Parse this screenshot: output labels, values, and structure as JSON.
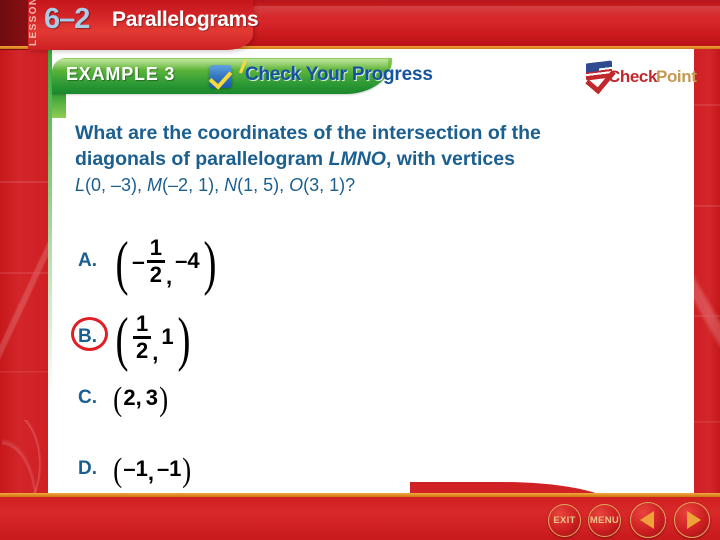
{
  "header": {
    "lesson_word": "LESSON",
    "lesson_number": "6–2",
    "lesson_title": "Parallelograms"
  },
  "banner": {
    "example_label": "EXAMPLE 3",
    "check_your_progress": "Check Your Progress",
    "checkbox_icon": "checkbox-check-icon"
  },
  "checkpoint_logo": {
    "check_word": "Check",
    "point_word": "Point",
    "flag_icon": "flag-check-icon",
    "check_color": "#c0282d",
    "point_color": "#c49a53"
  },
  "question": {
    "line1": "What are the coordinates of the intersection of the",
    "line2_pre": "diagonals of parallelogram ",
    "line2_var": "LMNO",
    "line2_post": ", with vertices",
    "line3_parts": [
      {
        "var": "L",
        "coords": "(0, –3), "
      },
      {
        "var": "M",
        "coords": "(–2, 1), "
      },
      {
        "var": "N",
        "coords": "(1, 5), "
      },
      {
        "var": "O",
        "coords": "(3, 1)?"
      }
    ],
    "text_color": "#1b5f90"
  },
  "choices": [
    {
      "letter": "A.",
      "circled": false,
      "type": "fraction-pair",
      "x_sign": "–",
      "x_num": "1",
      "x_den": "2",
      "y_value": "–4",
      "full_text": "(–1/2, –4)"
    },
    {
      "letter": "B.",
      "circled": true,
      "type": "fraction-pair",
      "x_sign": "",
      "x_num": "1",
      "x_den": "2",
      "y_value": "1",
      "full_text": "(1/2, 1)"
    },
    {
      "letter": "C.",
      "circled": false,
      "type": "plain-pair",
      "x_value": "2",
      "y_value": "3",
      "full_text": "(2, 3)"
    },
    {
      "letter": "D.",
      "circled": false,
      "type": "plain-pair",
      "x_value": "–1",
      "y_value": "–1",
      "full_text": "(–1, –1)"
    }
  ],
  "correct_answer_highlight_color": "#e01f26",
  "nav": {
    "exit_label": "EXIT",
    "menu_label": "MENU",
    "back_icon": "arrow-left-icon",
    "forward_icon": "arrow-right-icon"
  }
}
